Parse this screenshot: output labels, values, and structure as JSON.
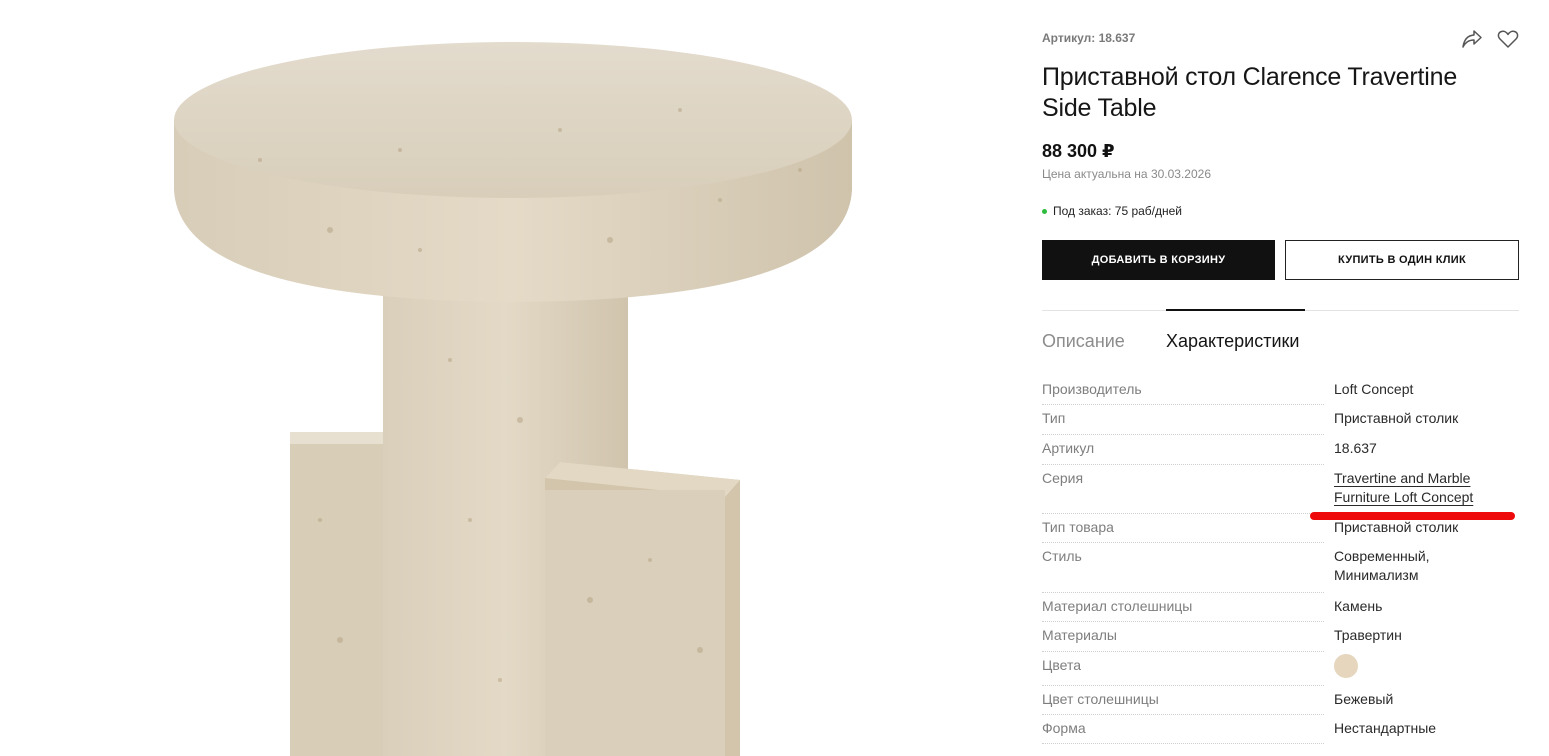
{
  "product": {
    "sku_label": "Артикул: 18.637",
    "title": "Приставной стол Clarence Travertine Side Table",
    "price": "88 300 ₽",
    "price_note": "Цена актуальна на 30.03.2026",
    "availability": "Под заказ: 75 раб/дней",
    "image_icon": "travertine-side-table-photo"
  },
  "actions": {
    "add_to_cart": "ДОБАВИТЬ В КОРЗИНУ",
    "buy_one_click": "КУПИТЬ В ОДИН КЛИК",
    "share_icon": "share-icon",
    "favorite_icon": "heart-icon"
  },
  "tabs": [
    {
      "label": "Описание",
      "active": false
    },
    {
      "label": "Характеристики",
      "active": true
    }
  ],
  "specs": [
    {
      "label": "Производитель",
      "value": "Loft Concept"
    },
    {
      "label": "Тип",
      "value": "Приставной столик"
    },
    {
      "label": "Артикул",
      "value": "18.637"
    },
    {
      "label": "Серия",
      "value_line1": "Travertine and Marble",
      "value_line2": "Furniture Loft Concept"
    },
    {
      "label": "Тип товара",
      "value": "Приставной столик"
    },
    {
      "label": "Стиль",
      "value_line1": "Современный,",
      "value_line2": "Минимализм"
    },
    {
      "label": "Материал столешницы",
      "value": "Камень"
    },
    {
      "label": "Материалы",
      "value": "Травертин"
    },
    {
      "label": "Цвета",
      "swatch_color": "#e6d6bd"
    },
    {
      "label": "Цвет столешницы",
      "value": "Бежевый"
    },
    {
      "label": "Форма",
      "value": "Нестандартные"
    }
  ],
  "colors": {
    "accent": "#111111",
    "availability_dot": "#2ebc3d",
    "annotation_mark": "#ee0a0a"
  }
}
